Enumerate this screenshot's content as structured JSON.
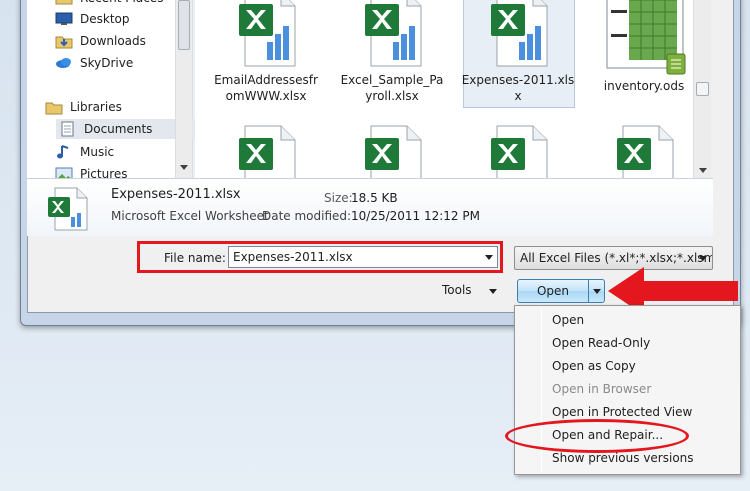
{
  "nav": {
    "items": [
      {
        "label": "Recent Places",
        "icon": "recent-places-icon"
      },
      {
        "label": "Desktop",
        "icon": "desktop-icon"
      },
      {
        "label": "Downloads",
        "icon": "downloads-folder-icon"
      },
      {
        "label": "SkyDrive",
        "icon": "skydrive-cloud-icon"
      },
      {
        "label": "Libraries",
        "icon": "libraries-icon"
      },
      {
        "label": "Documents",
        "icon": "documents-icon"
      },
      {
        "label": "Music",
        "icon": "music-icon"
      },
      {
        "label": "Pictures",
        "icon": "pictures-icon"
      }
    ],
    "selected": "Documents"
  },
  "files": [
    {
      "name": "EmailAddressesfr\nomWWW.xlsx",
      "icon": "excel-file-icon"
    },
    {
      "name": "Excel_Sample_Pa\nyroll.xlsx",
      "icon": "excel-file-icon"
    },
    {
      "name": "Expenses-2011.xls\nx",
      "icon": "excel-file-icon",
      "selected": true
    },
    {
      "name": "inventory.ods",
      "icon": "spreadsheet-preview-icon"
    },
    {
      "name": "",
      "icon": "excel-file-icon"
    },
    {
      "name": "",
      "icon": "excel-file-icon"
    },
    {
      "name": "",
      "icon": "excel-file-icon"
    },
    {
      "name": "",
      "icon": "excel-file-icon"
    }
  ],
  "details": {
    "name": "Expenses-2011.xlsx",
    "type": "Microsoft Excel Worksheet",
    "size_label": "Size:",
    "size_value": "18.5 KB",
    "modified_label": "Date modified:",
    "modified_value": "10/25/2011 12:12 PM"
  },
  "form": {
    "file_name_label": "File name:",
    "file_name_value": "Expenses-2011.xlsx",
    "filter_value": "All Excel Files (*.xl*;*.xlsx;*.xlsm;",
    "tools_label": "Tools",
    "open_label": "Open"
  },
  "menu": {
    "items": [
      {
        "label": "Open",
        "enabled": true
      },
      {
        "label": "Open Read-Only",
        "enabled": true
      },
      {
        "label": "Open as Copy",
        "enabled": true
      },
      {
        "label": "Open in Browser",
        "enabled": false
      },
      {
        "label": "Open in Protected View",
        "enabled": true
      },
      {
        "label": "Open and Repair...",
        "enabled": true
      },
      {
        "label": "Show previous versions",
        "enabled": true
      }
    ]
  },
  "colors": {
    "highlight": "#e3171d",
    "excel_green": "#1f7a3a"
  }
}
